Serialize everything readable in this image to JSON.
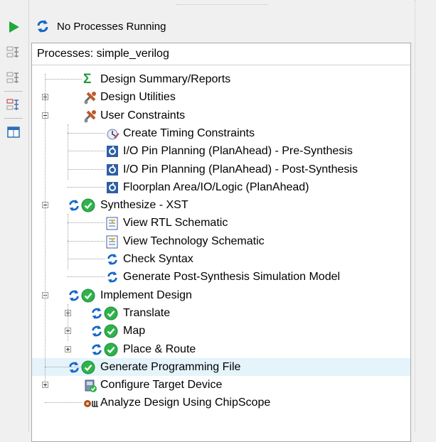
{
  "status": {
    "text": "No Processes Running"
  },
  "panel": {
    "header": "Processes: simple_verilog"
  },
  "tree": [
    {
      "label": "Design Summary/Reports",
      "icon": "sigma-icon",
      "level": 0,
      "expander": "none"
    },
    {
      "label": "Design Utilities",
      "icon": "tools-icon",
      "level": 0,
      "expander": "plus"
    },
    {
      "label": "User Constraints",
      "icon": "tools-icon",
      "level": 0,
      "expander": "minus"
    },
    {
      "label": "Create Timing Constraints",
      "icon": "timing-constraints-icon",
      "level": 1,
      "expander": "none"
    },
    {
      "label": "I/O Pin Planning (PlanAhead) - Pre-Synthesis",
      "icon": "planahead-icon",
      "level": 1,
      "expander": "none"
    },
    {
      "label": "I/O Pin Planning (PlanAhead) - Post-Synthesis",
      "icon": "planahead-icon",
      "level": 1,
      "expander": "none"
    },
    {
      "label": "Floorplan Area/IO/Logic (PlanAhead)",
      "icon": "planahead-icon",
      "level": 1,
      "expander": "none"
    },
    {
      "label": "Synthesize - XST",
      "icon": "run-success-icon",
      "level": 0,
      "expander": "minus"
    },
    {
      "label": "View RTL Schematic",
      "icon": "schematic-icon",
      "level": 1,
      "expander": "none"
    },
    {
      "label": "View Technology Schematic",
      "icon": "schematic-icon",
      "level": 1,
      "expander": "none"
    },
    {
      "label": "Check Syntax",
      "icon": "run-icon",
      "level": 1,
      "expander": "none"
    },
    {
      "label": "Generate Post-Synthesis Simulation Model",
      "icon": "run-icon",
      "level": 1,
      "expander": "none"
    },
    {
      "label": "Implement Design",
      "icon": "run-success-icon",
      "level": 0,
      "expander": "minus"
    },
    {
      "label": "Translate",
      "icon": "run-success-icon",
      "level": 1,
      "expander": "plus"
    },
    {
      "label": "Map",
      "icon": "run-success-icon",
      "level": 1,
      "expander": "plus"
    },
    {
      "label": "Place & Route",
      "icon": "run-success-icon",
      "level": 1,
      "expander": "plus"
    },
    {
      "label": "Generate Programming File",
      "icon": "run-success-icon",
      "level": 0,
      "expander": "none",
      "selected": true
    },
    {
      "label": "Configure Target Device",
      "icon": "device-icon",
      "level": 0,
      "expander": "plus"
    },
    {
      "label": "Analyze Design Using ChipScope",
      "icon": "chipscope-icon",
      "level": 0,
      "expander": "none"
    }
  ],
  "toolbar": [
    {
      "name": "run-icon-button",
      "icon": "play-icon"
    },
    {
      "name": "rerun-icon-button",
      "icon": "rerun-icon"
    },
    {
      "name": "rerun-all-icon-button",
      "icon": "rerun-all-icon"
    },
    {
      "name": "stop-icon-button",
      "icon": "stop-run-icon"
    },
    {
      "name": "properties-icon-button",
      "icon": "window-icon"
    }
  ],
  "colors": {
    "green": "#2db34a",
    "blue": "#1467c8",
    "orange": "#c0582a"
  }
}
